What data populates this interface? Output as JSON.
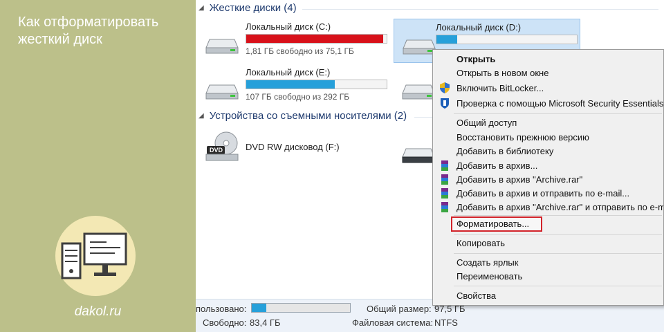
{
  "banner": {
    "title": "Как отформатировать жесткий диск",
    "site": "dakol.ru"
  },
  "hard_drives_group": {
    "title": "Жесткие диски (4)"
  },
  "drives": [
    {
      "name": "Локальный диск (C:)",
      "free": "1,81 ГБ свободно из 75,1 ГБ",
      "used_fraction": 0.976,
      "bar_color": "#d8111a"
    },
    {
      "name": "Локальный диск (D:)",
      "free": "",
      "used_fraction": 0.15,
      "bar_color": "#26a0da"
    },
    {
      "name": "Локальный диск (E:)",
      "free": "107 ГБ свободно из 292 ГБ",
      "used_fraction": 0.63,
      "bar_color": "#26a0da"
    }
  ],
  "removable_group": {
    "title": "Устройства со съемными носителями (2)"
  },
  "dvd": {
    "name": "DVD RW дисковод (F:)"
  },
  "status": {
    "used_label": "пользовано:",
    "used_fraction": 0.15,
    "free_label": "Свободно:",
    "free_value": "83,4 ГБ",
    "total_label": "Общий размер:",
    "total_value": "97,5 ГБ",
    "fs_label": "Файловая система:",
    "fs_value": "NTFS"
  },
  "context_menu": {
    "open": "Открыть",
    "open_new_window": "Открыть в новом окне",
    "bitlocker": "Включить BitLocker...",
    "mse_scan": "Проверка с помощью Microsoft Security Essentials...",
    "sharing": "Общий доступ",
    "restore": "Восстановить прежнюю версию",
    "add_library": "Добавить в библиотеку",
    "add_archive": "Добавить в архив...",
    "add_archive_rar": "Добавить в архив \"Archive.rar\"",
    "add_archive_email": "Добавить в архив и отправить по e-mail...",
    "add_archive_rar_email": "Добавить в архив \"Archive.rar\" и отправить по e-mail",
    "format": "Форматировать...",
    "copy": "Копировать",
    "create_shortcut": "Создать ярлык",
    "rename": "Переименовать",
    "properties": "Свойства"
  },
  "colors": {
    "banner_bg": "#bcc08a",
    "highlight": "#d2232a",
    "selection": "#cde3f7"
  }
}
